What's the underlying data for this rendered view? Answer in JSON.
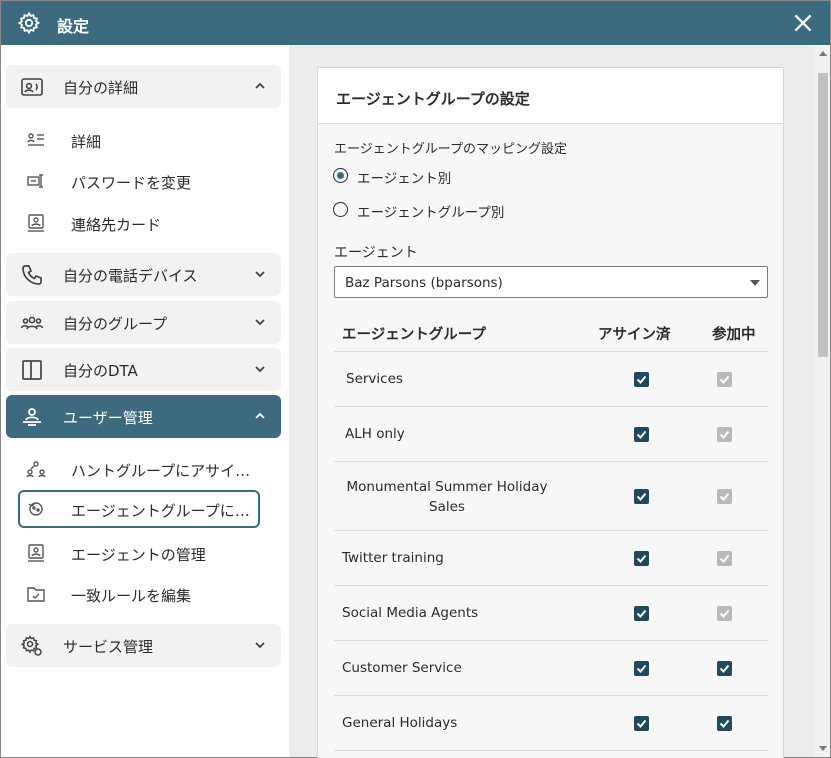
{
  "window": {
    "title": "設定",
    "close_icon": "close-icon",
    "gear_icon": "gear-icon"
  },
  "colors": {
    "accent": "#3d6a7e",
    "checkbox_checked": "#1f4a5e",
    "checkbox_disabled": "#b9b9b9"
  },
  "sidebar": {
    "my_details": {
      "label": "自分の詳細",
      "items": [
        {
          "label": "詳細",
          "icon": "details-list-icon"
        },
        {
          "label": "パスワードを変更",
          "icon": "password-icon"
        },
        {
          "label": "連絡先カード",
          "icon": "contact-card-icon"
        }
      ]
    },
    "my_phone_devices": {
      "label": "自分の電話デバイス",
      "icon": "phone-icon"
    },
    "my_groups": {
      "label": "自分のグループ",
      "icon": "group-icon"
    },
    "my_dta": {
      "label": "自分のDTA",
      "icon": "panel-icon"
    },
    "user_management": {
      "label": "ユーザー管理",
      "items": [
        {
          "label": "ハントグループにアサインする",
          "icon": "hunt-group-icon"
        },
        {
          "label": "エージェントグループにアサインする",
          "icon": "agent-group-icon"
        },
        {
          "label": "エージェントの管理",
          "icon": "agent-manage-icon"
        },
        {
          "label": "一致ルールを編集",
          "icon": "rule-folder-icon"
        }
      ]
    },
    "service_management": {
      "label": "サービス管理",
      "icon": "service-gear-icon"
    }
  },
  "main": {
    "panel_title": "エージェントグループの設定",
    "mapping_label": "エージェントグループのマッピング設定",
    "radio_by_agent": "エージェント別",
    "radio_by_group": "エージェントグループ別",
    "radio_selected": "by_agent",
    "agent_label": "エージェント",
    "agent_value": "Baz Parsons (bparsons)",
    "table": {
      "headers": {
        "group": "エージェントグループ",
        "assigned": "アサイン済",
        "joined": "参加中"
      },
      "rows": [
        {
          "name": "Services",
          "assigned": true,
          "joined": true,
          "joined_disabled": true
        },
        {
          "name": "ALH only",
          "assigned": true,
          "joined": true,
          "joined_disabled": true
        },
        {
          "name": "Monumental Summer Holiday Sales",
          "assigned": true,
          "joined": true,
          "joined_disabled": true
        },
        {
          "name": "Twitter training",
          "assigned": true,
          "joined": true,
          "joined_disabled": true
        },
        {
          "name": "Social Media Agents",
          "assigned": true,
          "joined": true,
          "joined_disabled": true
        },
        {
          "name": "Customer Service",
          "assigned": true,
          "joined": true,
          "joined_disabled": false
        },
        {
          "name": "General Holidays",
          "assigned": true,
          "joined": true,
          "joined_disabled": false
        }
      ]
    }
  }
}
